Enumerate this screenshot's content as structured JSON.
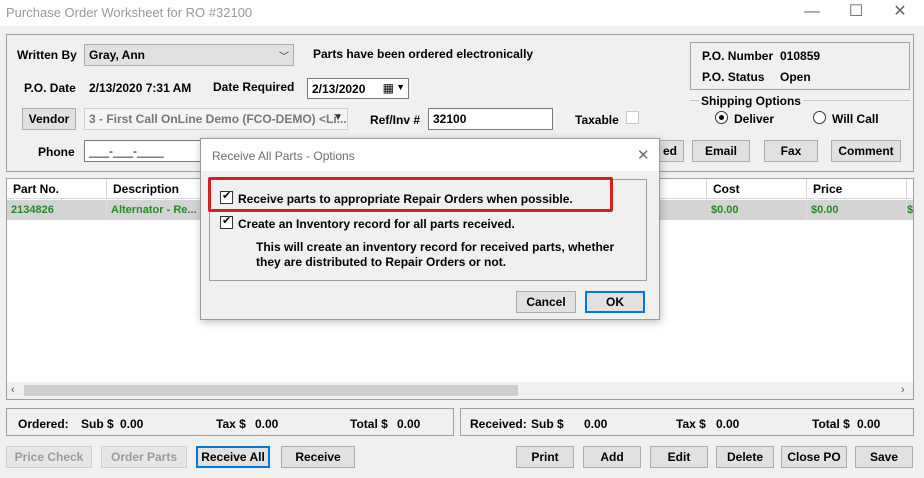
{
  "window": {
    "title": "Purchase Order Worksheet for RO #32100"
  },
  "header": {
    "written_by_label": "Written By",
    "written_by_value": "Gray, Ann",
    "ordered_msg": "Parts have been ordered electronically",
    "po_date_label": "P.O. Date",
    "po_date_value": "2/13/2020 7:31 AM",
    "date_required_label": "Date Required",
    "date_required_value": "2/13/2020",
    "vendor_button": "Vendor",
    "vendor_value": "3 - First Call OnLine Demo (FCO-DEMO) <Li...",
    "ref_inv_label": "Ref/Inv #",
    "ref_inv_value": "32100",
    "taxable_label": "Taxable",
    "phone_label": "Phone",
    "phone_value": "___-___-____"
  },
  "po_box": {
    "number_label": "P.O. Number",
    "number_value": "010859",
    "status_label": "P.O. Status",
    "status_value": "Open"
  },
  "shipping": {
    "title": "Shipping Options",
    "deliver": "Deliver",
    "will_call": "Will Call"
  },
  "actions": {
    "partial_label": "ed",
    "email": "Email",
    "fax": "Fax",
    "comment": "Comment"
  },
  "grid": {
    "headers": {
      "part_no": "Part No.",
      "description": "Description",
      "cost": "Cost",
      "price": "Price"
    },
    "row": {
      "part_no": "2134826",
      "description": "Alternator - Re...",
      "cost": "$0.00",
      "price": "$0.00",
      "extra": "$"
    }
  },
  "totals": {
    "ordered_label": "Ordered:",
    "ordered_sub_label": "Sub $",
    "ordered_sub": "0.00",
    "ordered_tax_label": "Tax $",
    "ordered_tax": "0.00",
    "ordered_total_label": "Total $",
    "ordered_total": "0.00",
    "received_label": "Received:",
    "received_sub_label": "Sub $",
    "received_sub": "0.00",
    "received_tax_label": "Tax $",
    "received_tax": "0.00",
    "received_total_label": "Total $",
    "received_total": "0.00"
  },
  "bottom_buttons": {
    "price_check": "Price Check",
    "order_parts": "Order Parts",
    "receive_all": "Receive All",
    "receive": "Receive",
    "print": "Print",
    "add": "Add",
    "edit": "Edit",
    "delete": "Delete",
    "close_po": "Close PO",
    "save": "Save"
  },
  "dialog": {
    "title": "Receive All Parts - Options",
    "option1": "Receive parts to appropriate Repair Orders when possible.",
    "option2": "Create an Inventory record for all parts received.",
    "option2_desc_line1": "This will create an inventory record for received parts, whether",
    "option2_desc_line2": "they are distributed to Repair Orders or not.",
    "cancel": "Cancel",
    "ok": "OK"
  },
  "colors": {
    "highlight": "#d61f1f",
    "green_text": "#228b22",
    "focus": "#0078d7"
  }
}
